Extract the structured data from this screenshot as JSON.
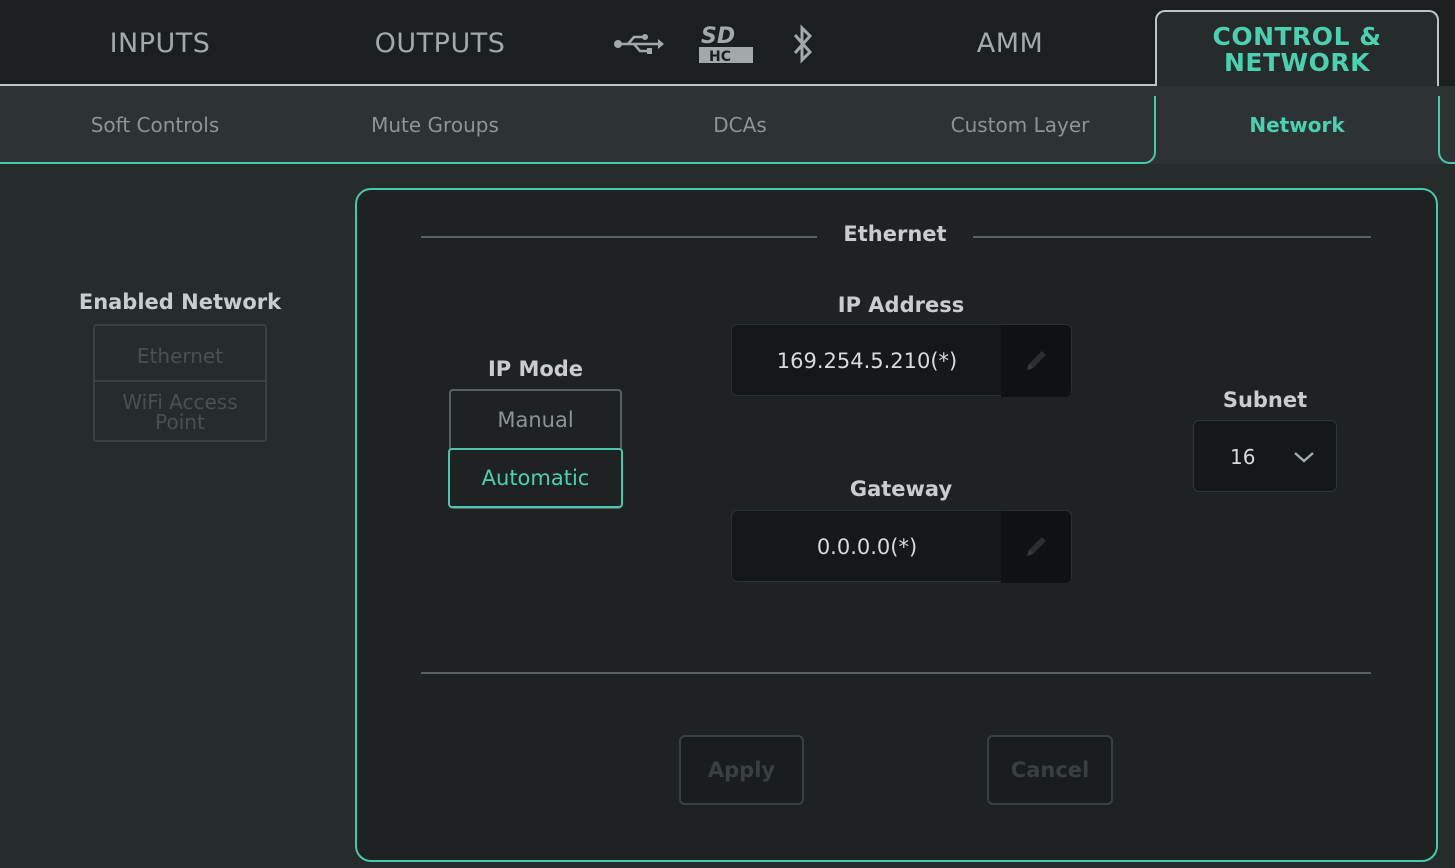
{
  "top_tabs": {
    "inputs": "INPUTS",
    "outputs": "OUTPUTS",
    "amm": "AMM",
    "control_line1": "CONTROL &",
    "control_line2": "NETWORK"
  },
  "top_icons": [
    "usb-icon",
    "sdhc-icon",
    "bluetooth-icon"
  ],
  "sub_tabs": {
    "soft_controls": "Soft Controls",
    "mute_groups": "Mute Groups",
    "dcas": "DCAs",
    "custom_layer": "Custom Layer",
    "network": "Network"
  },
  "enabled_network": {
    "title": "Enabled Network",
    "ethernet": "Ethernet",
    "wifi_line1": "WiFi Access",
    "wifi_line2": "Point"
  },
  "ethernet": {
    "section_title": "Ethernet",
    "ip_mode_label": "IP Mode",
    "mode_manual": "Manual",
    "mode_automatic": "Automatic",
    "ip_address_label": "IP Address",
    "ip_address_value": "169.254.5.210(*)",
    "gateway_label": "Gateway",
    "gateway_value": "0.0.0.0(*)",
    "subnet_label": "Subnet",
    "subnet_value": "16"
  },
  "actions": {
    "apply": "Apply",
    "cancel": "Cancel"
  },
  "colors": {
    "accent": "#4dd0b0",
    "background": "#262b2c",
    "panel": "#1e2223"
  }
}
